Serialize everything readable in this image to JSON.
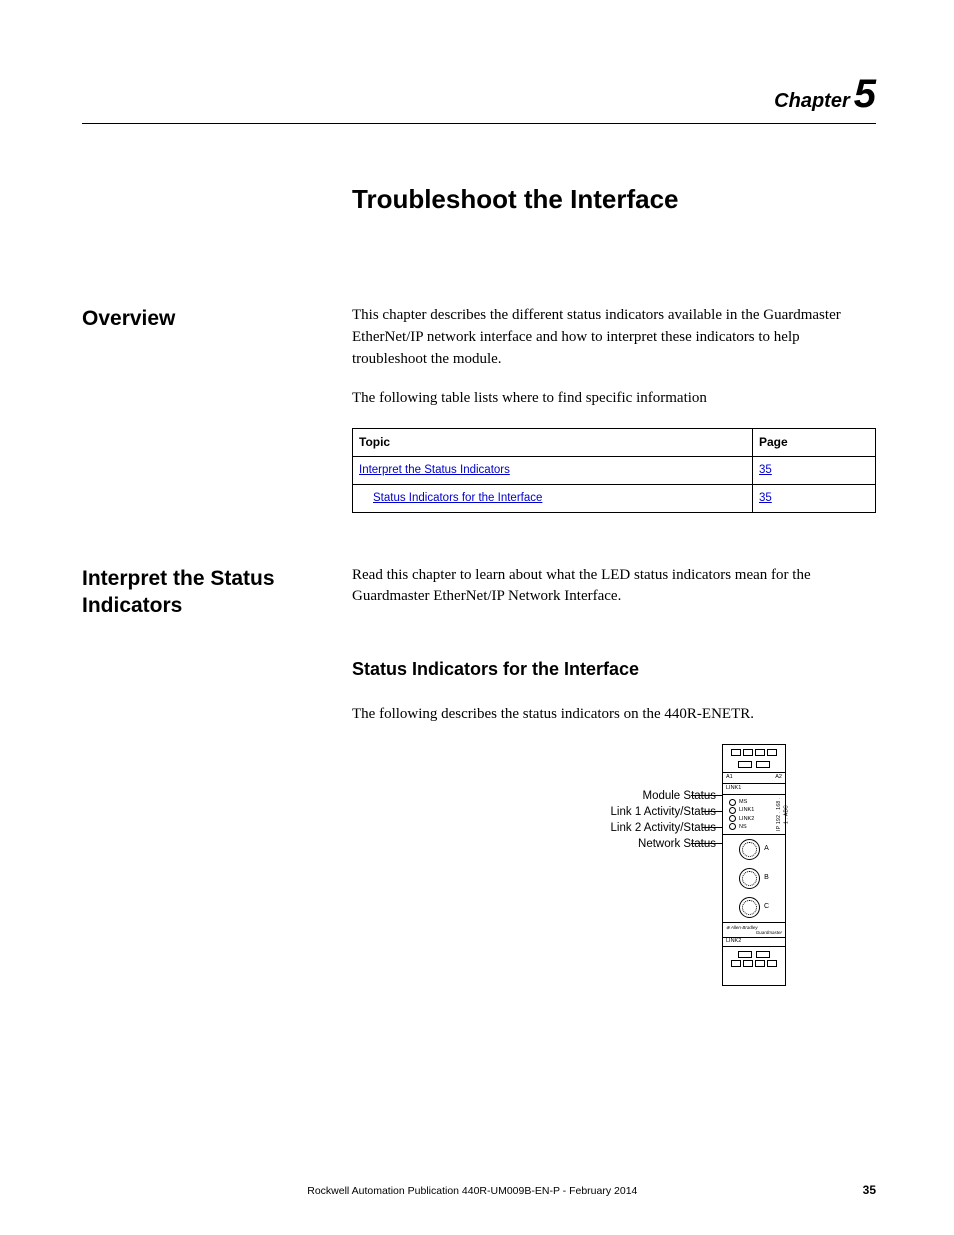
{
  "header": {
    "chapter_word": "Chapter",
    "chapter_number": "5"
  },
  "title": "Troubleshoot the Interface",
  "overview": {
    "heading": "Overview",
    "p1": "This chapter describes the different status indicators available in the Guardmaster EtherNet/IP network interface and how to interpret these indicators to help troubleshoot the module.",
    "p2": "The following table lists where to find specific information"
  },
  "topic_table": {
    "headers": {
      "topic": "Topic",
      "page": "Page"
    },
    "rows": [
      {
        "topic": "Interpret the Status Indicators",
        "page": "35"
      },
      {
        "topic": "Status Indicators for the Interface",
        "page": "35"
      }
    ]
  },
  "section2": {
    "heading": "Interpret the Status Indicators",
    "p1": "Read this chapter to learn about what the LED status indicators mean for the Guardmaster EtherNet/IP Network Interface.",
    "sub_heading": "Status Indicators for the Interface",
    "p2": "The following describes the status indicators on the 440R-ENETR."
  },
  "figure": {
    "callouts": {
      "c1": "Module Status",
      "c2": "Link 1 Activity/Status",
      "c3": "Link 2 Activity/Status",
      "c4": "Network Status"
    },
    "module": {
      "a1": "A1",
      "a2": "A2",
      "link1": "LINK1",
      "link2": "LINK2",
      "leds": {
        "ms": "MS",
        "l1": "LINK1",
        "l2": "LINK2",
        "ns": "NS"
      },
      "ip": "IP 192 . 168 . 1 . ABC",
      "dials": {
        "a": "A",
        "b": "B",
        "c": "C"
      },
      "brand1": "Allen-Bradley",
      "brand2": "Guardmaster"
    }
  },
  "footer": {
    "pub": "Rockwell Automation Publication 440R-UM009B-EN-P - February 2014",
    "page": "35"
  }
}
